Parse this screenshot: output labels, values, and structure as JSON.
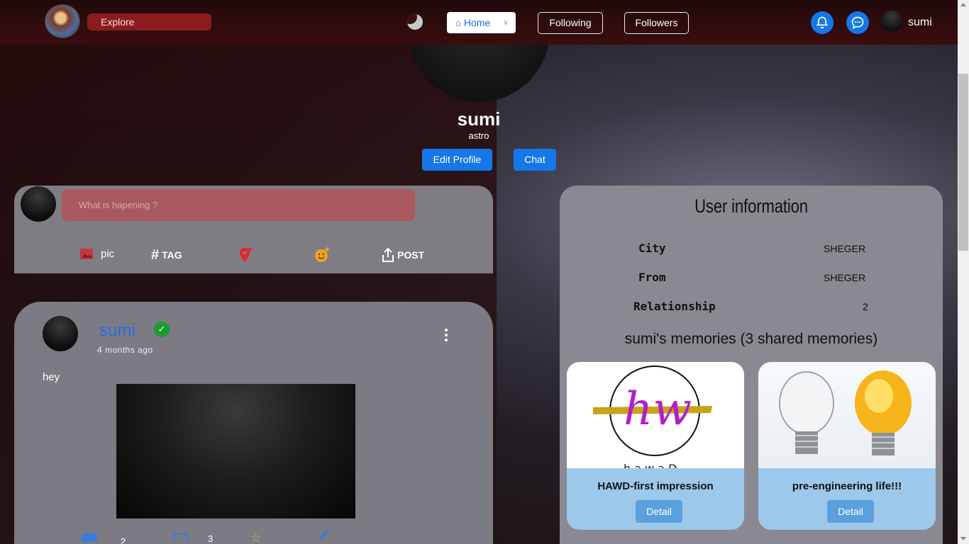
{
  "navbar": {
    "explore_label": "Explore",
    "home_label": "Home",
    "following_label": "Following",
    "followers_label": "Followers",
    "username": "sumi"
  },
  "profile": {
    "name": "sumi",
    "subtitle": "astro",
    "edit_label": "Edit Profile",
    "chat_label": "Chat"
  },
  "composer": {
    "placeholder": "What is hapening ?",
    "pic_label": "pic",
    "tag_label": "TAG",
    "post_label": "POST"
  },
  "post": {
    "username": "sumi",
    "time": "4 months ago",
    "text": "hey",
    "like_count": "2",
    "comment_count": "3"
  },
  "user_info": {
    "title": "User information",
    "fields": [
      {
        "label": "City",
        "value": "SHEGER"
      },
      {
        "label": "From",
        "value": "SHEGER"
      },
      {
        "label": "Relationship",
        "value": "2"
      }
    ],
    "memories_title": "sumi's memories (3 shared memories)",
    "memories": [
      {
        "name": "HAWD-first impression",
        "button": "Detail"
      },
      {
        "name": "pre-engineering life!!!",
        "button": "Detail"
      }
    ]
  },
  "colors": {
    "accent_blue": "#1577e8",
    "explore_red": "#8b1c1d",
    "verified_green": "#1b9a30"
  },
  "icons": [
    "moon-icon",
    "home-icon",
    "bell-icon",
    "chat-icon",
    "image-icon",
    "hash-icon",
    "location-icon",
    "emoji-icon",
    "share-icon",
    "verified-icon",
    "kebab-icon",
    "like-icon",
    "comment-icon",
    "star-icon"
  ]
}
